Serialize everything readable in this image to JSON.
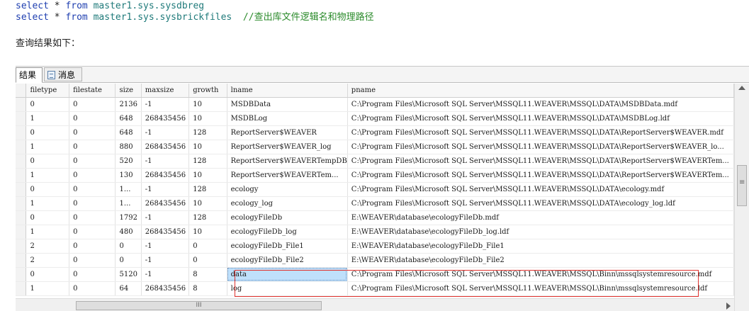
{
  "sql": {
    "line1": {
      "kw1": "select",
      "star": " * ",
      "kw2": "from",
      "obj": "master1.sys.sysdbreg"
    },
    "line2": {
      "kw1": "select",
      "star": " * ",
      "kw2": "from",
      "obj": "master1.sys.sysbrickfiles",
      "comment": "  //查出库文件逻辑名和物理路径"
    }
  },
  "caption": "查询结果如下：",
  "tabs": {
    "results": "结果",
    "messages": "消息"
  },
  "grid": {
    "columns": [
      "filetype",
      "filestate",
      "size",
      "maxsize",
      "growth",
      "lname",
      "pname"
    ],
    "rows": [
      [
        "0",
        "0",
        "2136",
        "-1",
        "10",
        "MSDBData",
        "C:\\Program Files\\Microsoft SQL Server\\MSSQL11.WEAVER\\MSSQL\\DATA\\MSDBData.mdf"
      ],
      [
        "1",
        "0",
        "648",
        "268435456",
        "10",
        "MSDBLog",
        "C:\\Program Files\\Microsoft SQL Server\\MSSQL11.WEAVER\\MSSQL\\DATA\\MSDBLog.ldf"
      ],
      [
        "0",
        "0",
        "648",
        "-1",
        "128",
        "ReportServer$WEAVER",
        "C:\\Program Files\\Microsoft SQL Server\\MSSQL11.WEAVER\\MSSQL\\DATA\\ReportServer$WEAVER.mdf"
      ],
      [
        "1",
        "0",
        "880",
        "268435456",
        "10",
        "ReportServer$WEAVER_log",
        "C:\\Program Files\\Microsoft SQL Server\\MSSQL11.WEAVER\\MSSQL\\DATA\\ReportServer$WEAVER_lo..."
      ],
      [
        "0",
        "0",
        "520",
        "-1",
        "128",
        "ReportServer$WEAVERTempDB",
        "C:\\Program Files\\Microsoft SQL Server\\MSSQL11.WEAVER\\MSSQL\\DATA\\ReportServer$WEAVERTem..."
      ],
      [
        "1",
        "0",
        "130",
        "268435456",
        "10",
        "ReportServer$WEAVERTem...",
        "C:\\Program Files\\Microsoft SQL Server\\MSSQL11.WEAVER\\MSSQL\\DATA\\ReportServer$WEAVERTem..."
      ],
      [
        "0",
        "0",
        "1...",
        "-1",
        "128",
        "ecology",
        "C:\\Program Files\\Microsoft SQL Server\\MSSQL11.WEAVER\\MSSQL\\DATA\\ecology.mdf"
      ],
      [
        "1",
        "0",
        "1...",
        "268435456",
        "10",
        "ecology_log",
        "C:\\Program Files\\Microsoft SQL Server\\MSSQL11.WEAVER\\MSSQL\\DATA\\ecology_log.ldf"
      ],
      [
        "0",
        "0",
        "1792",
        "-1",
        "128",
        "ecologyFileDb",
        "E:\\WEAVER\\database\\ecologyFileDb.mdf"
      ],
      [
        "1",
        "0",
        "480",
        "268435456",
        "10",
        "ecologyFileDb_log",
        "E:\\WEAVER\\database\\ecologyFileDb_log.ldf"
      ],
      [
        "2",
        "0",
        "0",
        "-1",
        "0",
        "ecologyFileDb_File1",
        "E:\\WEAVER\\database\\ecologyFileDb_File1"
      ],
      [
        "2",
        "0",
        "0",
        "-1",
        "0",
        "ecologyFileDb_File2",
        "E:\\WEAVER\\database\\ecologyFileDb_File2"
      ],
      [
        "0",
        "0",
        "5120",
        "-1",
        "8",
        "data",
        "C:\\Program Files\\Microsoft SQL Server\\MSSQL11.WEAVER\\MSSQL\\Binn\\mssqlsystemresource.mdf"
      ],
      [
        "1",
        "0",
        "64",
        "268435456",
        "8",
        "log",
        "C:\\Program Files\\Microsoft SQL Server\\MSSQL11.WEAVER\\MSSQL\\Binn\\mssqlsystemresource.ldf"
      ]
    ],
    "selected_cell": {
      "row": 12,
      "column": "lname"
    },
    "highlighted_rows": [
      6,
      7
    ]
  },
  "scrollbars": {
    "grip": "III"
  },
  "colors": {
    "keyword": "#1f3fb0",
    "object": "#1f7a7a",
    "comment": "#2b8b2b",
    "highlight_border": "#e0332f",
    "selection": "#bfe0fb"
  }
}
